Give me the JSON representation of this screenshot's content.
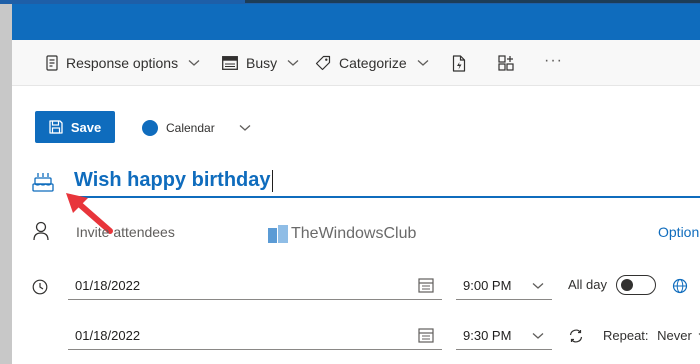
{
  "toolbar": {
    "response_options": "Response options",
    "busy": "Busy",
    "categorize": "Categorize",
    "more": "···"
  },
  "header": {
    "save_label": "Save",
    "calendar_label": "Calendar"
  },
  "event": {
    "title": "Wish happy birthday",
    "attendees_placeholder": "Invite attendees",
    "options_link": "Option"
  },
  "schedule": {
    "start_date": "01/18/2022",
    "start_time": "9:00 PM",
    "end_date": "01/18/2022",
    "end_time": "9:30 PM",
    "all_day_label": "All day",
    "all_day_on": false,
    "repeat_label": "Repeat:",
    "repeat_value": "Never"
  },
  "watermark": {
    "text": "TheWindowsClub"
  },
  "colors": {
    "accent": "#0f6cbd",
    "arrow": "#e8353b"
  }
}
